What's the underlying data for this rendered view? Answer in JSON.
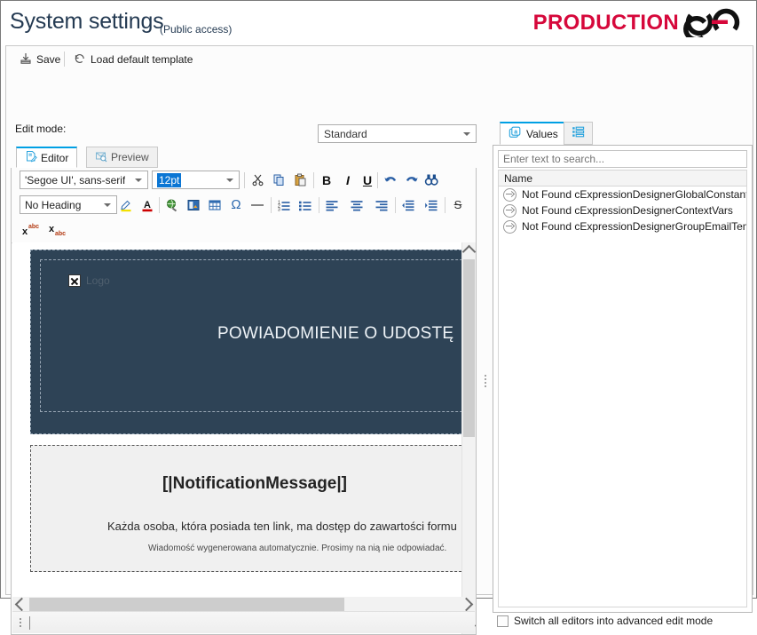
{
  "header": {
    "title": "System settings",
    "subtitle": "(Public access)",
    "brand_text": "PRODUCTION",
    "brand_color": "#d6083b",
    "brand_mark_icon": "chain-link-icon"
  },
  "command_bar": {
    "save_label": "Save",
    "save_icon": "save-icon",
    "load_default_label": "Load default template",
    "load_default_icon": "undo-circle-icon"
  },
  "edit_mode": {
    "label": "Edit mode:",
    "value": "Standard",
    "options": [
      "Standard"
    ]
  },
  "editor_tabs": [
    {
      "label": "Editor",
      "icon": "document-edit-icon",
      "active": true
    },
    {
      "label": "Preview",
      "icon": "envelope-search-icon",
      "active": false
    }
  ],
  "toolbar": {
    "font_family": "'Segoe UI', sans-serif",
    "font_size": "12pt",
    "heading": "No Heading",
    "row1_icons": [
      "cut-icon",
      "copy-icon",
      "paste-icon",
      "bold-icon",
      "italic-icon",
      "underline-icon",
      "undo-icon",
      "redo-icon",
      "find-icon"
    ],
    "row2_icons": [
      "highlight-pen-icon",
      "font-color-icon",
      "insert-link-icon",
      "insert-image-icon",
      "insert-table-icon",
      "special-character-icon",
      "horizontal-rule-icon",
      "numbered-list-icon",
      "bullet-list-icon",
      "align-left-icon",
      "align-center-icon",
      "align-right-icon",
      "outdent-icon",
      "indent-icon",
      "strikethrough-icon"
    ],
    "row3_icons": [
      "superscript-icon",
      "subscript-icon"
    ],
    "bold_label": "B",
    "italic_label": "I",
    "underline_label": "U",
    "omega_label": "Ω",
    "strikethrough_label": "S"
  },
  "document": {
    "logo_alt": "Logo",
    "logo_icon": "broken-image-icon",
    "hero_title": "POWIADOMIENIE O UDOSTĘ",
    "hero_bg": "#2e4356",
    "body_title": "[|NotificationMessage|]",
    "body_line": "Każda osoba, która posiada ten link, ma dostęp do zawartości formu",
    "body_footer": "Wiadomość wygenerowana automatycznie. Prosimy na nią nie odpowiadać."
  },
  "scrollbars": {
    "v_up_icon": "chevron-up-icon",
    "v_down_icon": "chevron-down-icon",
    "h_left_icon": "chevron-left-icon",
    "h_right_icon": "chevron-right-icon"
  },
  "values_panel": {
    "tabs": [
      {
        "label": "Values",
        "icon": "values-a-icon",
        "active": true
      },
      {
        "label": "",
        "icon": "list-grid-icon",
        "active": false
      }
    ],
    "search_placeholder": "Enter text to search...",
    "search_value": "",
    "column_header": "Name",
    "rows": [
      {
        "icon": "go-arrow-icon",
        "label": "Not Found cExpressionDesignerGlobalConstants"
      },
      {
        "icon": "go-arrow-icon",
        "label": "Not Found cExpressionDesignerContextVars"
      },
      {
        "icon": "go-arrow-icon",
        "label": "Not Found cExpressionDesignerGroupEmailTemplate"
      }
    ]
  },
  "footer": {
    "advanced_mode_label": "Switch all editors into advanced edit mode",
    "advanced_mode_checked": false
  }
}
